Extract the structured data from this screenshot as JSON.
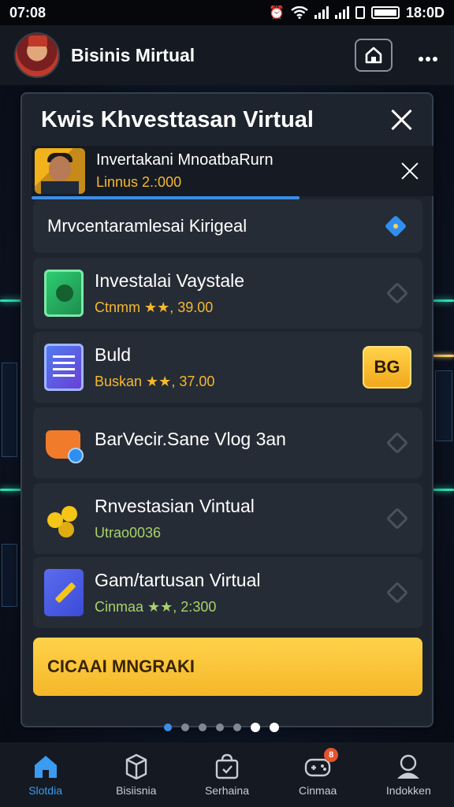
{
  "status_bar": {
    "time": "07:08",
    "clock_right": "18:0D"
  },
  "app": {
    "title": "Bisinis Mirtual"
  },
  "modal": {
    "title": "Kwis Khvesttasan Virtual",
    "notification": {
      "title": "Invertakani MnoatbaRurn",
      "subtitle": "Linnus 2.:000"
    },
    "header_row": "Mrvcentaramlesai Kirigeal",
    "items": [
      {
        "title": "Investalai Vaystale",
        "subtitle": "Ctnmm ★★, 39.00",
        "subtitle_color": "#f5b82e",
        "icon": "green-app-icon",
        "action": "chevron"
      },
      {
        "title": "Buld",
        "subtitle": "Buskan ★★, 37.00",
        "subtitle_color": "#f5b82e",
        "icon": "document-list-icon",
        "action": "button",
        "button_label": "BG"
      },
      {
        "title": "BarVecir.Sane Vlog 3an",
        "subtitle": "",
        "subtitle_color": "#f5b82e",
        "icon": "bucket-icon",
        "action": "chevron"
      },
      {
        "title": "Rnvestasian Vintual",
        "subtitle": "Utrao0036",
        "subtitle_color": "#a6d36a",
        "icon": "coins-icon",
        "action": "chevron"
      },
      {
        "title": "Gam/tartusan Virtual",
        "subtitle": "Cinmaa ★★, 2:300",
        "subtitle_color": "#a6d36a",
        "icon": "pencil-icon",
        "action": "chevron"
      }
    ],
    "cta_label": "CICAAI MNGRAKI",
    "pager": {
      "count": 7,
      "active": 5
    }
  },
  "bottom_nav": [
    {
      "label": "Slotdia",
      "icon": "home-icon",
      "active": true
    },
    {
      "label": "Bisiisnia",
      "icon": "box-icon",
      "active": false
    },
    {
      "label": "Serhaina",
      "icon": "bag-icon",
      "active": false
    },
    {
      "label": "Cinmaa",
      "icon": "gamepad-icon",
      "active": false,
      "badge": "8"
    },
    {
      "label": "Indokken",
      "icon": "profile-icon",
      "active": false
    }
  ],
  "colors": {
    "accent": "#3a9bf0",
    "cta": "#f5b729",
    "gold_text": "#f5b82e"
  }
}
